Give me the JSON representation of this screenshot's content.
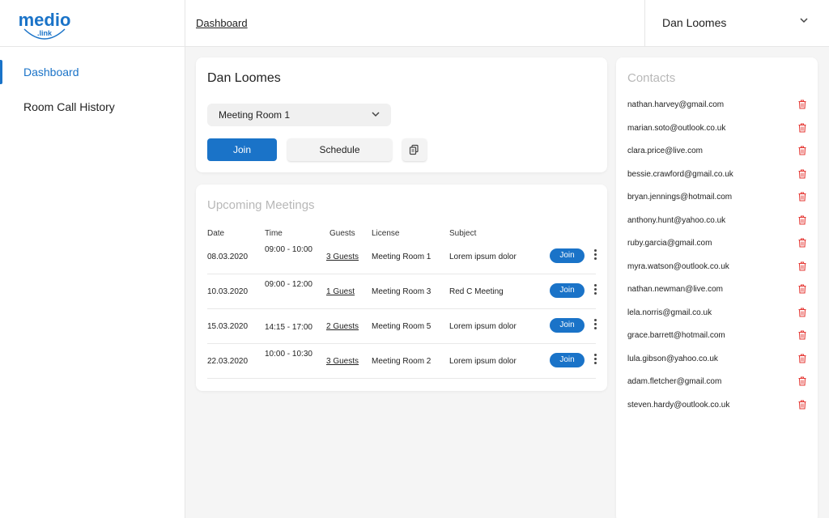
{
  "brand": {
    "logo_text": "medio",
    "logo_sub": ".link",
    "color": "#1a73c8"
  },
  "header": {
    "breadcrumb": "Dashboard",
    "user_name": "Dan Loomes"
  },
  "sidebar": {
    "items": [
      {
        "label": "Dashboard",
        "active": true
      },
      {
        "label": "Room Call History",
        "active": false
      }
    ]
  },
  "room_card": {
    "title": "Dan Loomes",
    "selected_room": "Meeting Room 1",
    "join_label": "Join",
    "schedule_label": "Schedule"
  },
  "meetings": {
    "title": "Upcoming Meetings",
    "headers": {
      "date": "Date",
      "time": "Time",
      "guests": "Guests",
      "license": "License",
      "subject": "Subject"
    },
    "join_label": "Join",
    "rows": [
      {
        "date": "08.03.2020",
        "time": "09:00 - 10:00",
        "guests": "3 Guests",
        "license": "Meeting Room 1",
        "subject": "Lorem ipsum dolor"
      },
      {
        "date": "10.03.2020",
        "time": "09:00 - 12:00",
        "guests": "1 Guest",
        "license": "Meeting Room 3",
        "subject": "Red C Meeting"
      },
      {
        "date": "15.03.2020",
        "time": "14:15 - 17:00",
        "guests": "2 Guests",
        "license": "Meeting Room 5",
        "subject": "Lorem ipsum dolor"
      },
      {
        "date": "22.03.2020",
        "time": "10:00 - 10:30",
        "guests": "3 Guests",
        "license": "Meeting Room 2",
        "subject": "Lorem ipsum dolor"
      }
    ]
  },
  "contacts": {
    "title": "Contacts",
    "items": [
      "nathan.harvey@gmail.com",
      "marian.soto@outlook.co.uk",
      "clara.price@live.com",
      "bessie.crawford@gmail.co.uk",
      "bryan.jennings@hotmail.com",
      "anthony.hunt@yahoo.co.uk",
      "ruby.garcia@gmail.com",
      "myra.watson@outlook.co.uk",
      "nathan.newman@live.com",
      "lela.norris@gmail.co.uk",
      "grace.barrett@hotmail.com",
      "lula.gibson@yahoo.co.uk",
      "adam.fletcher@gmail.com",
      "steven.hardy@outlook.co.uk"
    ],
    "delete_icon": "trash-icon",
    "delete_color": "#e53935"
  }
}
